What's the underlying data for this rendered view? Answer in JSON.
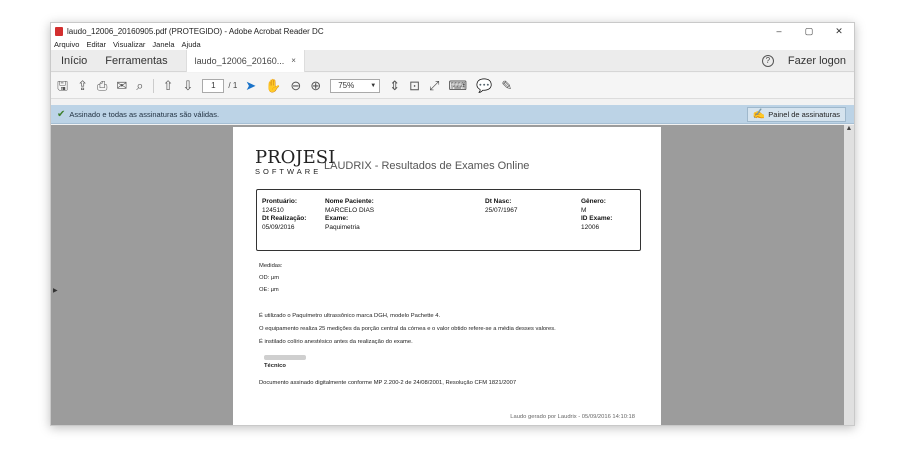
{
  "window": {
    "title": "laudo_12006_20160905.pdf (PROTEGIDO) - Adobe Acrobat Reader DC",
    "controls": {
      "minimize": "–",
      "maximize": "▢",
      "close": "✕"
    }
  },
  "menu": [
    "Arquivo",
    "Editar",
    "Visualizar",
    "Janela",
    "Ajuda"
  ],
  "nav": {
    "home": "Início",
    "tools": "Ferramentas",
    "doc_tab": "laudo_12006_20160...",
    "doc_tab_close": "×",
    "login": "Fazer logon"
  },
  "toolbar": {
    "page_current": "1",
    "page_total": "/ 1",
    "zoom": "75%"
  },
  "signature_bar": {
    "message": "Assinado e todas as assinaturas são válidas.",
    "panel_button": "Painel de assinaturas"
  },
  "document": {
    "logo_top": "PROJESI",
    "logo_bottom": "SOFTWARE",
    "report_title": "LAUDRIX - Resultados de Exames Online",
    "patient": {
      "prontuario_label": "Prontuário:",
      "prontuario": "124510",
      "realizacao_label": "Dt Realização:",
      "realizacao": "05/09/2016",
      "paciente_label": "Nome Paciente:",
      "paciente": "MARCELO DIAS",
      "exame_label": "Exame:",
      "exame": "Paquimetria",
      "nasc_label": "Dt Nasc:",
      "nasc": "25/07/1967",
      "genero_label": "Gênero:",
      "genero": "M",
      "id_label": "ID Exame:",
      "id": "12006"
    },
    "lines": {
      "medidas": "Medidas:",
      "od": "OD: µm",
      "oe": "OE: µm",
      "p1": "É utilizado o Paquímetro ultrassônico marca DGH, modelo Pachette 4.",
      "p2": "O equipamento realiza 25 medições da porção central da córnea e o valor obtido refere-se a média desses valores.",
      "p3": "É instilado colírio anestésico antes da realização do exame.",
      "tecnico": "Técnico",
      "assinado": "Documento assinado digitalmente conforme MP 2.200-2 de 24/08/2001, Resolução CFM 1821/2007",
      "footer": "Laudo gerado por Laudrix - 05/09/2016 14:10:18"
    }
  }
}
